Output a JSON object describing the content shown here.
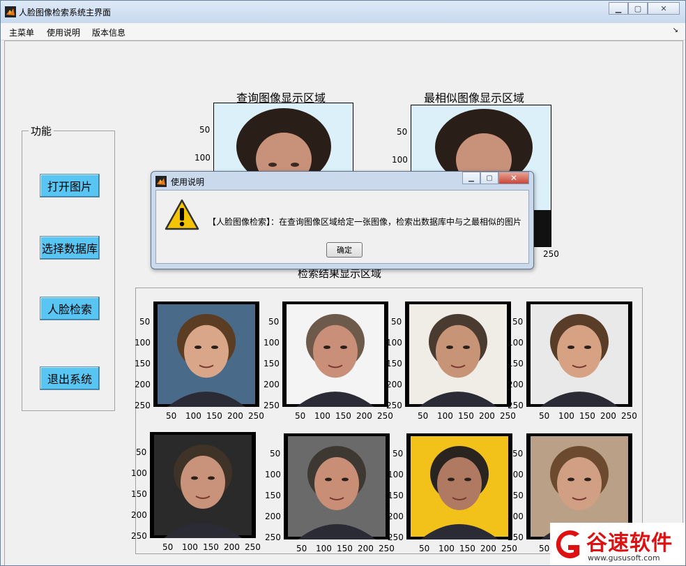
{
  "window": {
    "title": "人脸图像检索系统主界面"
  },
  "menu": {
    "items": [
      "主菜单",
      "使用说明",
      "版本信息"
    ]
  },
  "panel": {
    "title": "功能",
    "buttons": [
      "打开图片",
      "选择数据库",
      "人脸检索",
      "退出系统"
    ]
  },
  "query_axes": {
    "title": "查询图像显示区域",
    "yticks": [
      "50",
      "100"
    ]
  },
  "best_axes": {
    "title": "最相似图像显示区域",
    "yticks": [
      "50",
      "100"
    ],
    "xtick_last": "250"
  },
  "results": {
    "title": "检索结果显示区域",
    "yticks": [
      "50",
      "100",
      "150",
      "200",
      "250"
    ],
    "xticks": [
      "50",
      "100",
      "150",
      "200",
      "250"
    ]
  },
  "dialog": {
    "title": "使用说明",
    "message": "【人脸图像检索】：在查询图像区域给定一张图像，检索出数据库中与之最相似的图片",
    "ok_label": "确定"
  },
  "watermark": {
    "name": "谷速软件",
    "url": "www.gususoft.com"
  },
  "colors": {
    "button": "#58c5f2",
    "title_bar": "#c7d8ee",
    "watermark_red": "#dd1111"
  }
}
